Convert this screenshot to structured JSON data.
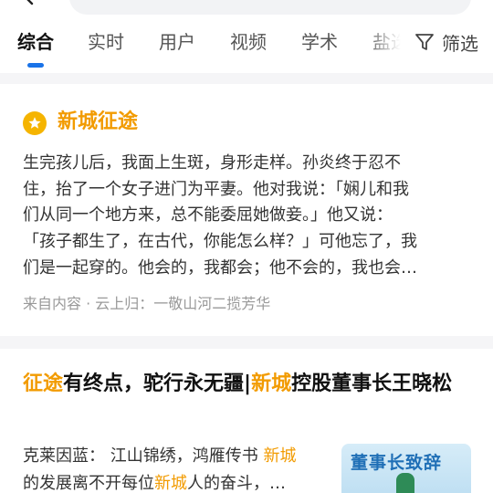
{
  "tabs": [
    {
      "label": "综合"
    },
    {
      "label": "实时"
    },
    {
      "label": "用户"
    },
    {
      "label": "视频"
    },
    {
      "label": "学术"
    },
    {
      "label": "盐选"
    }
  ],
  "filter_label": "筛选",
  "card1": {
    "title": "新城征途",
    "body_lines": [
      "生完孩儿后，我面上生斑，身形走样。孙炎终于忍不",
      "住，抬了一个女子进门为平妻。他对我说：「娴儿和我",
      "们从同一个地方来，总不能委屈她做妾。」他又说：",
      "「孩子都生了，在古代，你能怎么样？」可他忘了，我",
      "们是一起穿的。他会的，我都会；他不会的，我也会…"
    ],
    "source": "来自内容 · 云上归：一敬山河二揽芳华"
  },
  "card2": {
    "title_parts": [
      "征途",
      "有终点，驼行永无疆|",
      "新城",
      "控股董事长王晓松"
    ],
    "body_line1_prefix": "克莱因蓝：  江山锦绣，鸿雁传书 ",
    "body_line1_hl": "新城",
    "body_line2_prefix": "的发展离不开每位",
    "body_line2_hl": "新城",
    "body_line2_suffix": "人的奋斗，…",
    "thumb_text": "董事长致辞"
  },
  "colors": {
    "accent": "#1a73e8",
    "highlight": "#f29b00",
    "star": "#f5b400"
  }
}
